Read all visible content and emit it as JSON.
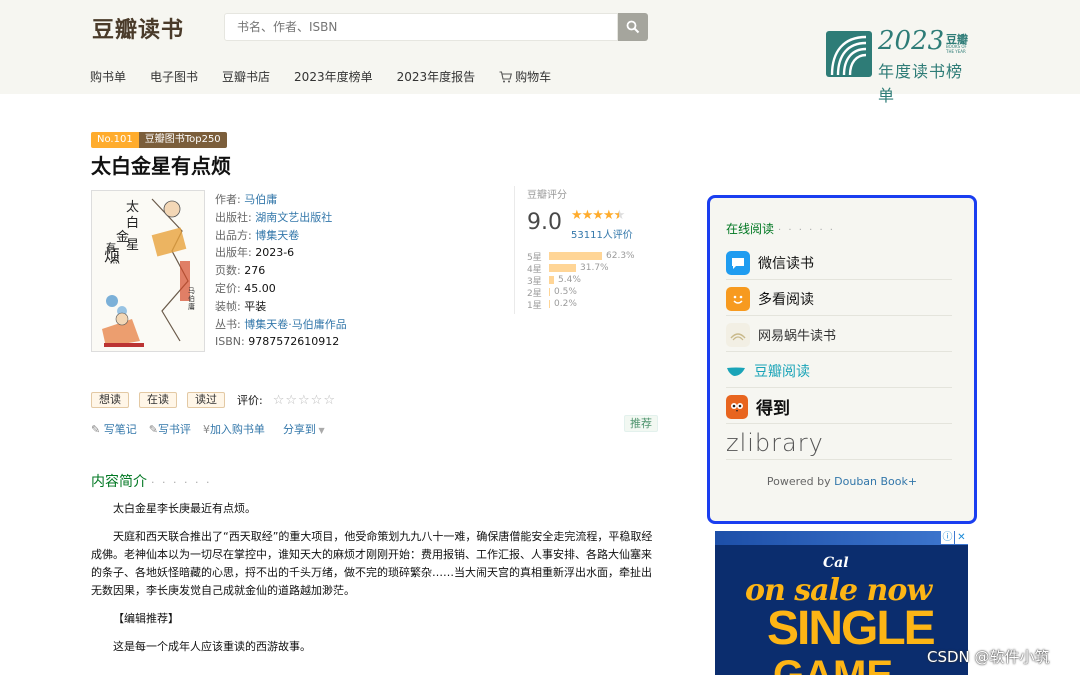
{
  "header": {
    "logo": "豆瓣读书",
    "search_placeholder": "书名、作者、ISBN",
    "nav": [
      "购书单",
      "电子图书",
      "豆瓣书店",
      "2023年度榜单",
      "2023年度报告",
      "购物车"
    ],
    "annual": {
      "year": "2023",
      "brand": "豆瓣",
      "small": "BOOKS OF THE YEAR",
      "subtitle": "年度读书榜单"
    }
  },
  "book": {
    "rank_no": "No.101",
    "rank_list": "豆瓣图书Top250",
    "title": "太白金星有点烦",
    "info": [
      {
        "label": "作者:",
        "value": "马伯庸",
        "link": true
      },
      {
        "label": "出版社:",
        "value": "湖南文艺出版社",
        "link": true
      },
      {
        "label": "出品方:",
        "value": "博集天卷",
        "link": true
      },
      {
        "label": "出版年:",
        "value": "2023-6",
        "link": false
      },
      {
        "label": "页数:",
        "value": "276",
        "link": false
      },
      {
        "label": "定价:",
        "value": "45.00",
        "link": false
      },
      {
        "label": "装帧:",
        "value": "平装",
        "link": false
      },
      {
        "label": "丛书:",
        "value": "博集天卷·马伯庸作品",
        "link": true
      },
      {
        "label": "ISBN:",
        "value": "9787572610912",
        "link": false
      }
    ],
    "cover_text": "太白金星有点烦",
    "cover_author": "马伯庸"
  },
  "rating": {
    "label": "豆瓣评分",
    "score": "9.0",
    "stars": 4.5,
    "votes": "53111人评价",
    "distribution": [
      {
        "star": "5星",
        "pct": "62.3%",
        "value": 62.3
      },
      {
        "star": "4星",
        "pct": "31.7%",
        "value": 31.7
      },
      {
        "star": "3星",
        "pct": "5.4%",
        "value": 5.4
      },
      {
        "star": "2星",
        "pct": "0.5%",
        "value": 0.5
      },
      {
        "star": "1星",
        "pct": "0.2%",
        "value": 0.2
      }
    ]
  },
  "actions": {
    "want": "想读",
    "reading": "在读",
    "read": "读过",
    "rate_label": "评价:",
    "links": [
      "写笔记",
      "写书评",
      "加入购书单",
      "分享到"
    ],
    "recommend": "推荐"
  },
  "intro": {
    "heading": "内容简介",
    "dots": "· · · · · ·",
    "paragraphs": [
      "太白金星李长庚最近有点烦。",
      "天庭和西天联合推出了“西天取经”的重大项目，他受命策划九九八十一难，确保唐僧能安全走完流程，平稳取经成佛。老神仙本以为一切尽在掌控中，谁知天大的麻烦才刚刚开始：费用报销、工作汇报、人事安排、各路大仙塞来的条子、各地妖怪暗藏的心思，捋不出的千头万绪，做不完的琐碎繁杂……当大闹天宫的真相重新浮出水面，牵扯出无数因果，李长庚发觉自己成就金仙的道路越加渺茫。",
      "【编辑推荐】",
      "这是每一个成年人应该重读的西游故事。"
    ]
  },
  "online_reading": {
    "heading": "在线阅读",
    "dots": "· · · · · ·",
    "vendors": [
      "微信读书",
      "多看阅读",
      "网易蜗牛读书",
      "豆瓣阅读",
      "得到",
      "zlibrary"
    ],
    "powered_prefix": "Powered by ",
    "powered_link": "Douban Book+"
  },
  "ad": {
    "brand": "Cal",
    "line1": "on sale now",
    "line2": "SINGLE",
    "line3": "GAME"
  },
  "watermark": "CSDN @软件小筑"
}
